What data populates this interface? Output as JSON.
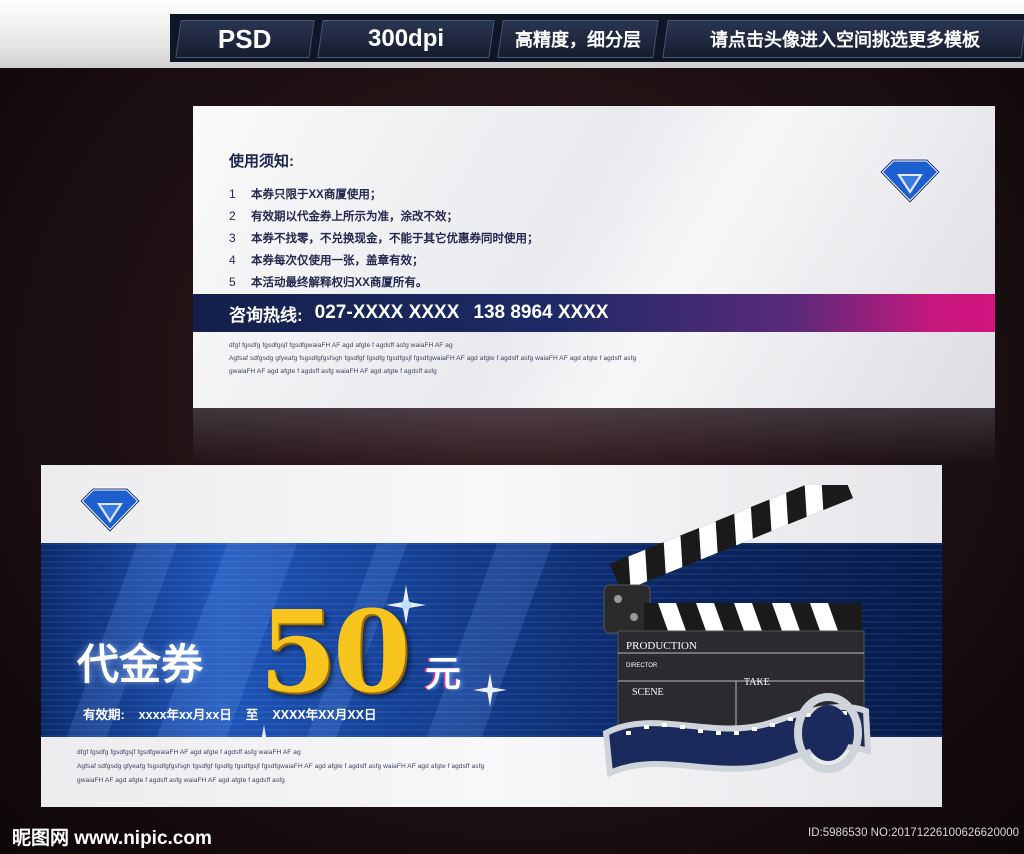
{
  "top_banner": {
    "tabs": [
      "PSD",
      "300dpi",
      "高精度，细分层",
      "请点击头像进入空间挑选更多模板"
    ]
  },
  "back_card": {
    "notice_title": "使用须知:",
    "rules": [
      {
        "num": "1",
        "text": "本券只限于XX商厦使用；"
      },
      {
        "num": "2",
        "text": "有效期以代金券上所示为准，涂改不效；"
      },
      {
        "num": "3",
        "text": "本券不找零，不兑换现金，不能于其它优惠券同时使用；"
      },
      {
        "num": "4",
        "text": "本券每次仅使用一张，盖章有效；"
      },
      {
        "num": "5",
        "text": "本活动最终解释权归XX商厦所有。"
      }
    ],
    "hotline_label": "咨询热线:",
    "phone1": "027-XXXX XXXX",
    "phone2": "138 8964 XXXX",
    "filler_lines": [
      "dfgf fgsdfg   fgsdfgsjf fgsdfgwaiaFH AF agd afgte f agdsff   asfg   waiaFH AF ag",
      "Agfsaf sdfgsdg gfyeafg fsgsdfgfgsfsgh fgsdfgf fgsdfg   fgsdfgsjf fgsdfgwaiaFH AF agd afgte f agdsff   asfg   waiaFH AF agd afgte f agdsff   asfg",
      "gwaiaFH AF agd afgte f agdsff   asfg   waiaFH AF agd afgte f agdsff   asfg"
    ]
  },
  "front_card": {
    "title": "代金券",
    "amount": "50",
    "unit": "元",
    "validity_label": "有效期:",
    "validity_from": "xxxx年xx月xx日",
    "validity_to_word": "至",
    "validity_to": "XXXX年XX月XX日",
    "filler_lines": [
      "dfgf fgsdfg   fgsdfgsjf fgsdfgwaiaFH AF agd afgte f agdsff   asfg   waiaFH AF ag",
      "Agfsaf sdfgsdg gfyeafg fsgsdfgfgsfsgh fgsdfgf fgsdfg   fgsdfgsjf fgsdfgwaiaFH AF agd afgte f agdsff   asfg   waiaFH AF agd afgte f agdsff   asfg",
      "gwaiaFH AF agd afgte f agdsff   asfg   waiaFH AF agd afgte f agdsff   asfg"
    ],
    "clapper_labels": {
      "production": "PRODUCTION",
      "director": "DIRECTOR",
      "scene": "SCENE",
      "take": "TAKE"
    }
  },
  "watermark": {
    "left": "昵图网 www.nipic.com",
    "right": "ID:5986530 NO:20171226100626620000"
  },
  "colors": {
    "navy": "#14204a",
    "magenta": "#d4137f",
    "gold": "#f7c51e",
    "band_blue": "#1d54b8"
  }
}
